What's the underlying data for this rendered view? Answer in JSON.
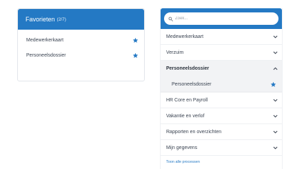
{
  "favorites": {
    "title": "Favorieten",
    "count": "(2/7)",
    "items": [
      {
        "label": "Medewerkerkaart"
      },
      {
        "label": "Personeelsdossier"
      }
    ]
  },
  "processes": {
    "search": {
      "placeholder": "Zoek..."
    },
    "items": [
      {
        "label": "Medewerkerkaart"
      },
      {
        "label": "Verzuim"
      },
      {
        "label": "Personeelsdossier",
        "expanded": true,
        "children": [
          {
            "label": "Personeelsdossier"
          }
        ]
      },
      {
        "label": "HR Core en Payroll"
      },
      {
        "label": "Vakantie en verlof"
      },
      {
        "label": "Rapporten en overzichten"
      },
      {
        "label": "Mijn gegevens"
      }
    ],
    "footer_link": "Toon alle processen"
  },
  "colors": {
    "accent": "#2479c4",
    "star": "#2479c4",
    "expanded_bg": "#f2f3f5"
  }
}
